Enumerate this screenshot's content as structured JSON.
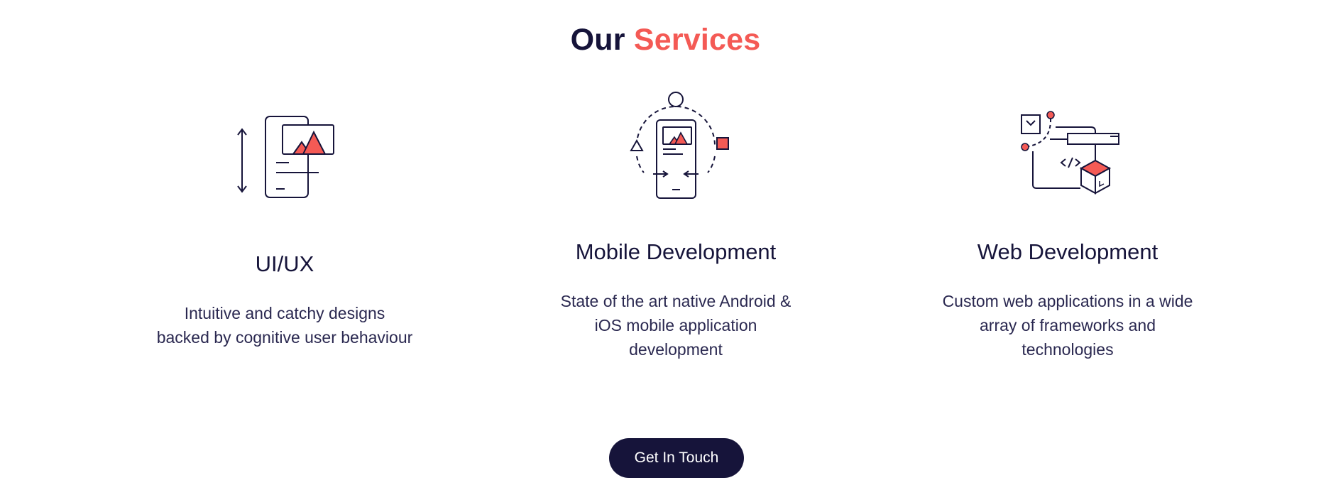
{
  "section": {
    "heading_part1": "Our",
    "heading_part2": "Services"
  },
  "colors": {
    "dark": "#16143a",
    "accent": "#f45a55"
  },
  "services": [
    {
      "icon": "ui-ux-illustration-icon",
      "title": "UI/UX",
      "description_lines": [
        "Intuitive and catchy designs",
        "backed by cognitive user behaviour"
      ]
    },
    {
      "icon": "mobile-development-illustration-icon",
      "title": "Mobile Development",
      "description_lines": [
        "State of the art native Android &",
        "iOS mobile application",
        "development"
      ]
    },
    {
      "icon": "web-development-illustration-icon",
      "title": "Web Development",
      "description_lines": [
        "Custom web applications in a wide",
        "array of frameworks and",
        "technologies"
      ]
    }
  ],
  "cta": {
    "label": "Get In Touch"
  }
}
